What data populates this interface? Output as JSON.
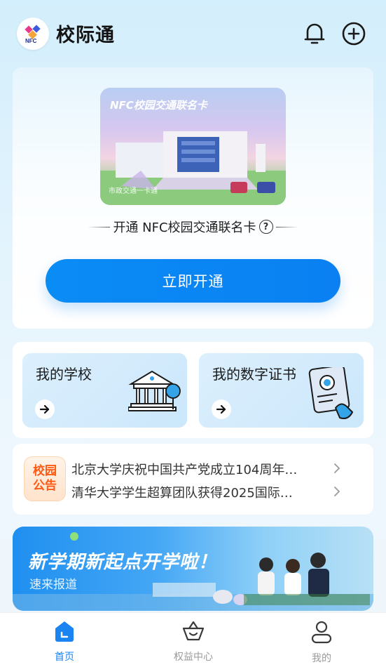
{
  "header": {
    "app_title": "校际通",
    "logo_icon": "campus-logo-icon",
    "notification_icon": "bell-icon",
    "add_icon": "plus-circle-icon"
  },
  "nfc": {
    "card_title": "NFC校园交通联名卡",
    "card_brand": "市政交通一卡通",
    "description": "开通 NFC校园交通联名卡",
    "help_icon": "question-circle-icon",
    "button_label": "立即开通"
  },
  "features": [
    {
      "label": "我的学校",
      "icon": "school-building-icon"
    },
    {
      "label": "我的数字证书",
      "icon": "certificate-icon"
    }
  ],
  "notice": {
    "badge": [
      "校园",
      "公告"
    ],
    "items": [
      "北京大学庆祝中国共产党成立104周年…",
      "清华大学学生超算团队获得2025国际…"
    ]
  },
  "banner": {
    "title": "新学期新起点开学啦！",
    "subtitle": "速来报道"
  },
  "bottom_nav": [
    {
      "label": "首页",
      "icon": "home-icon",
      "active": true
    },
    {
      "label": "权益中心",
      "icon": "basket-icon",
      "active": false
    },
    {
      "label": "我的",
      "icon": "user-icon",
      "active": false
    }
  ],
  "colors": {
    "accent": "#0a85f3",
    "notice_orange": "#ff5a14",
    "page_bg_top": "#d3eefc"
  }
}
